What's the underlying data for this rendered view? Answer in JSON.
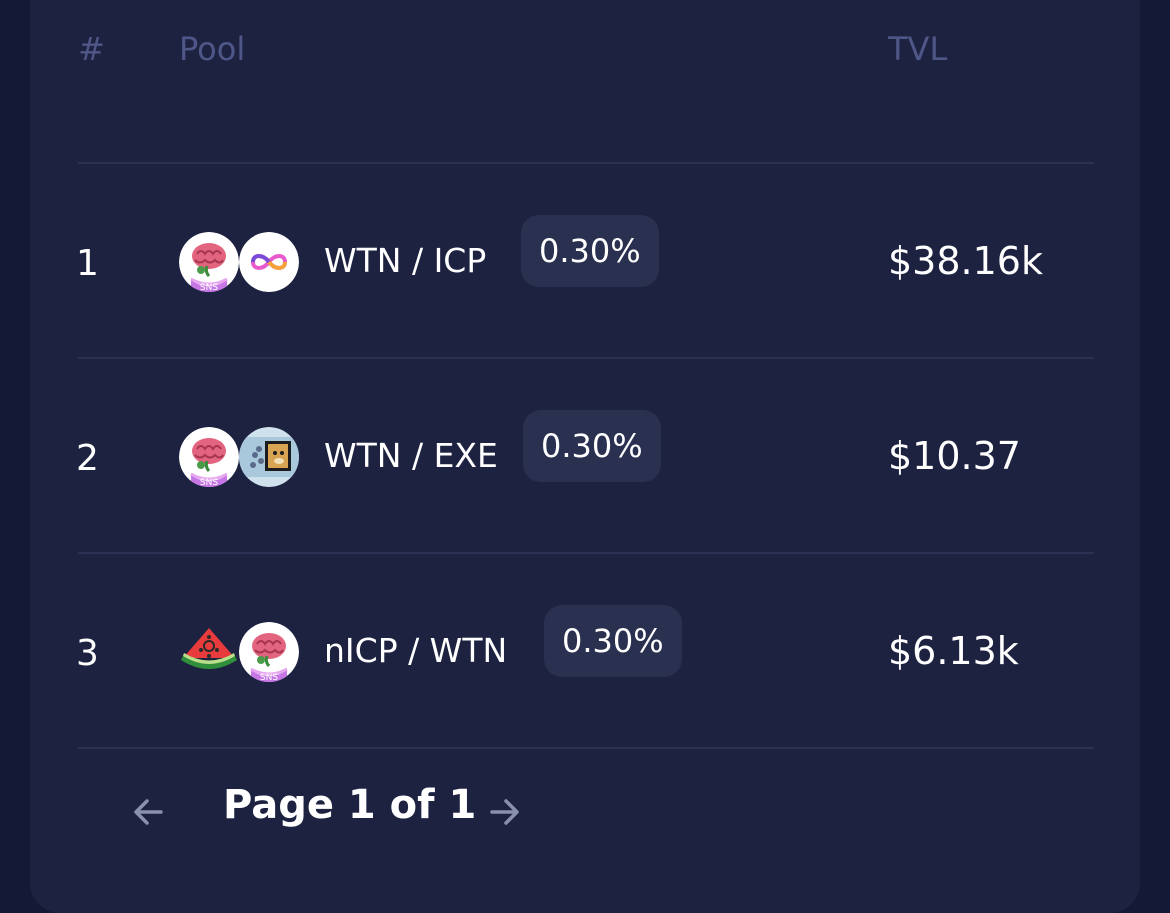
{
  "table": {
    "headers": {
      "num": "#",
      "pool": "Pool",
      "tvl": "TVL"
    },
    "rows": [
      {
        "index": "1",
        "pair": "WTN / ICP",
        "fee": "0.30%",
        "tvl": "$38.16k",
        "token_a": "brain-sns-icon",
        "token_b": "icp-infinity-icon"
      },
      {
        "index": "2",
        "pair": "WTN / EXE",
        "fee": "0.30%",
        "tvl": "$10.37",
        "token_a": "brain-sns-icon",
        "token_b": "exe-doge-icon"
      },
      {
        "index": "3",
        "pair": "nICP / WTN",
        "fee": "0.30%",
        "tvl": "$6.13k",
        "token_a": "watermelon-icon",
        "token_b": "brain-sns-icon"
      }
    ]
  },
  "pagination": {
    "label": "Page 1 of 1"
  },
  "colors": {
    "background": "#141a35",
    "card": "#1d2240",
    "header_text": "#4f5788",
    "divider": "#2b3153",
    "fee_badge": "#2a3050",
    "arrow": "#8a90b0"
  }
}
